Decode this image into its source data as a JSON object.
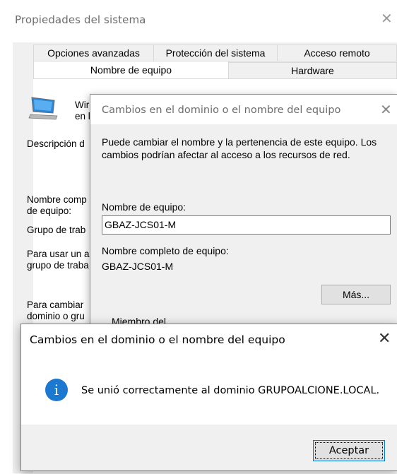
{
  "back_window": {
    "title": "Propiedades del sistema",
    "close_glyph": "✕",
    "tabs_row1": [
      "Opciones avanzadas",
      "Protección del sistema",
      "Acceso remoto"
    ],
    "tabs_row2": [
      "Nombre de equipo",
      "Hardware"
    ],
    "selected_tab": "Nombre de equipo",
    "content": {
      "win_line1": "Wir",
      "win_line2": "en l",
      "descripcion": "Descripción d",
      "nombre_comp_1": "Nombre comp",
      "nombre_comp_2": "de equipo:",
      "grupo": "Grupo de trab",
      "para_usar_1": "Para usar un a",
      "para_usar_2": "grupo de traba",
      "para_cambiar_1": "Para cambiar",
      "para_cambiar_2": "dominio o gru"
    }
  },
  "mid_dialog": {
    "title": "Cambios en el dominio o el nombre del equipo",
    "close_glyph": "✕",
    "description": "Puede cambiar el nombre y la pertenencia de este equipo. Los cambios podrían afectar al acceso a los recursos de red.",
    "computer_name_label": "Nombre de equipo:",
    "computer_name_value": "GBAZ-JCS01-M",
    "full_name_label": "Nombre completo de equipo:",
    "full_name_value": "GBAZ-JCS01-M",
    "more_button": "Más...",
    "member_of_label": "Miembro del"
  },
  "top_dialog": {
    "title": "Cambios en el dominio o el nombre del equipo",
    "close_glyph": "✕",
    "info_glyph": "i",
    "message": "Se unió correctamente al dominio GRUPOALCIONE.LOCAL.",
    "accept_button": "Aceptar"
  },
  "colors": {
    "info_blue": "#1d79d0",
    "focus_border": "#0078d7",
    "dialog_bg": "#f0f0f0"
  }
}
